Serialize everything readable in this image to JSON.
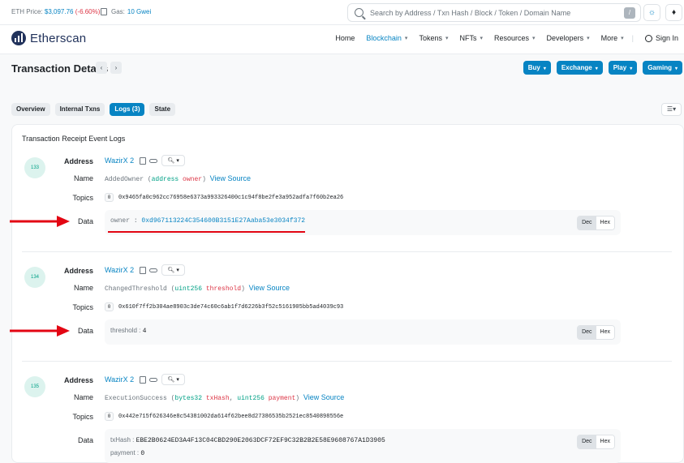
{
  "topbar": {
    "eth_price_label": "ETH Price:",
    "eth_price": "$3,097.76",
    "eth_change": "(-6.60%)",
    "gas_label": "Gas:",
    "gas_value": "10 Gwei",
    "search_placeholder": "Search by Address / Txn Hash / Block / Token / Domain Name",
    "search_shortcut": "/"
  },
  "nav": {
    "logo": "Etherscan",
    "items": [
      {
        "label": "Home",
        "dropdown": false
      },
      {
        "label": "Blockchain",
        "dropdown": true,
        "active": true
      },
      {
        "label": "Tokens",
        "dropdown": true
      },
      {
        "label": "NFTs",
        "dropdown": true
      },
      {
        "label": "Resources",
        "dropdown": true
      },
      {
        "label": "Developers",
        "dropdown": true
      },
      {
        "label": "More",
        "dropdown": true
      }
    ],
    "sign_in": "Sign In"
  },
  "page": {
    "title": "Transaction Details",
    "prev": "‹",
    "next": "›",
    "header_buttons": [
      "Buy",
      "Exchange",
      "Play",
      "Gaming"
    ]
  },
  "tabs": [
    "Overview",
    "Internal Txns",
    "Logs (3)",
    "State"
  ],
  "active_tab": "Logs (3)",
  "card_title": "Transaction Receipt Event Logs",
  "labels": {
    "address": "Address",
    "name": "Name",
    "topics": "Topics",
    "data": "Data",
    "view_source": "View Source",
    "dec": "Dec",
    "hex": "Hex"
  },
  "logs": [
    {
      "index": "133",
      "address": "WazirX 2",
      "event_name": "AddedOwner",
      "params": [
        {
          "type": "address",
          "name": "owner"
        }
      ],
      "topic_index": "0",
      "topic": "0x9465fa0c962cc76958e6373a993326400c1c94f8be2fe3a952adfa7f60b2ea26",
      "data": [
        {
          "key": "owner",
          "value": "0xd967113224C354600B3151E27Aaba53e3034f372",
          "is_link": true
        }
      ]
    },
    {
      "index": "134",
      "address": "WazirX 2",
      "event_name": "ChangedThreshold",
      "params": [
        {
          "type": "uint256",
          "name": "threshold"
        }
      ],
      "topic_index": "0",
      "topic": "0x610f7ff2b304ae8903c3de74c60c6ab1f7d6226b3f52c5161905bb5ad4039c93",
      "data": [
        {
          "key": "threshold",
          "value": "4",
          "is_link": false
        }
      ]
    },
    {
      "index": "135",
      "address": "WazirX 2",
      "event_name": "ExecutionSuccess",
      "params": [
        {
          "type": "bytes32",
          "name": "txHash"
        },
        {
          "type": "uint256",
          "name": "payment"
        }
      ],
      "topic_index": "0",
      "topic": "0x442e715f626346e8c54381002da614f62bee8d27386535b2521ec8540898556e",
      "data": [
        {
          "key": "txHash",
          "value": "EBE2B0624ED3A4F13C04CBD290E2063DCF72EF9C32B2B2E58E9608767A1D3905",
          "is_link": false
        },
        {
          "key": "payment",
          "value": "0",
          "is_link": false
        }
      ]
    }
  ],
  "colors": {
    "accent": "#0784c3",
    "annotation_red": "#e30613",
    "negative": "#dc3545",
    "param_type": "#00a186"
  }
}
